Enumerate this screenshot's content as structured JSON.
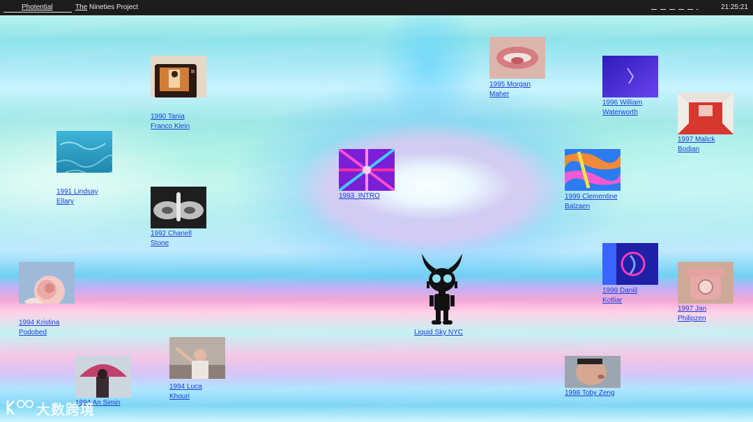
{
  "topbar": {
    "brand": "Photential",
    "project_prefix": "The",
    "project_name": "Nineties Project",
    "clock": "21:25:21"
  },
  "logo": {
    "label": "Liquid Sky NYC",
    "icon": "alien-robot-icon"
  },
  "watermark": {
    "text": "大数跨境",
    "icon": "kk-logo-icon"
  },
  "cards": [
    {
      "line1": "1990 Tania",
      "line2": "Franco Klein"
    },
    {
      "line1": "1991 Lindsay",
      "line2": "Ellary"
    },
    {
      "line1": "1992 Chanell",
      "line2": "Stone"
    },
    {
      "line1": "1994 Kristina",
      "line2": "Podobed"
    },
    {
      "line1": "1994 An Simin",
      "line2": ""
    },
    {
      "line1": "1994 Luca",
      "line2": "Khouri"
    },
    {
      "line1": "1993_INTRO",
      "line2": ""
    },
    {
      "line1": "1995 Morgan",
      "line2": "Maher"
    },
    {
      "line1": "1996 William",
      "line2": "Waterworth"
    },
    {
      "line1": "1997 Malick",
      "line2": "Bodian"
    },
    {
      "line1": "1999 Clementine",
      "line2": "Balzaen"
    },
    {
      "line1": "1999 Daniil",
      "line2": "Kotliar"
    },
    {
      "line1": "1997 Jan",
      "line2": "Philipzen"
    },
    {
      "line1": "1998 Toby Zeng",
      "line2": ""
    }
  ],
  "colors": {
    "link": "#1a3fd6",
    "topbar": "#1c1c1c"
  }
}
